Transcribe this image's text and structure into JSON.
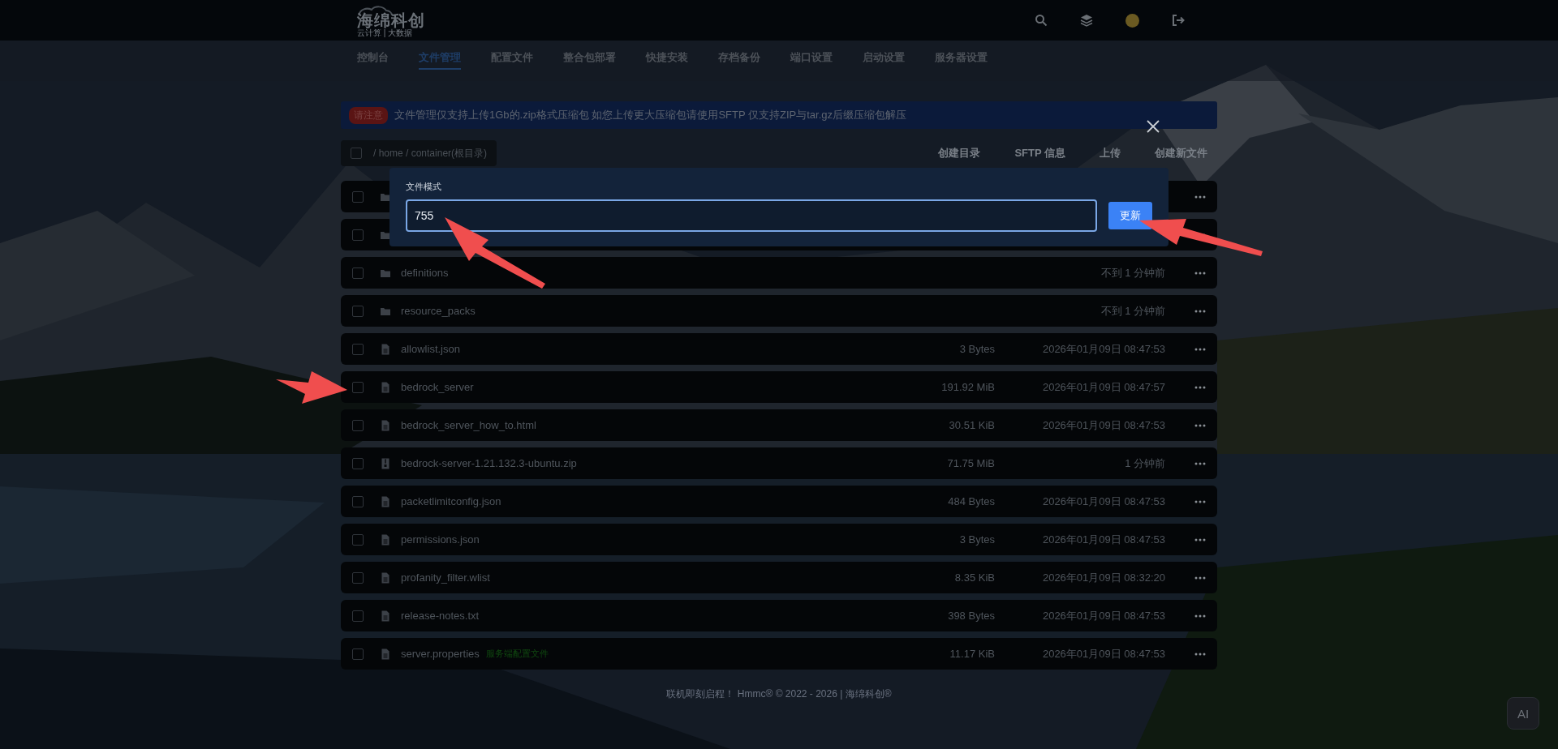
{
  "header": {
    "logo_title": "海绵科创",
    "logo_subtitle": "云计算 | 大数据"
  },
  "nav": [
    {
      "label": "控制台",
      "selected": false
    },
    {
      "label": "文件管理",
      "selected": true
    },
    {
      "label": "配置文件",
      "selected": false
    },
    {
      "label": "整合包部署",
      "selected": false
    },
    {
      "label": "快捷安装",
      "selected": false
    },
    {
      "label": "存档备份",
      "selected": false
    },
    {
      "label": "端口设置",
      "selected": false
    },
    {
      "label": "启动设置",
      "selected": false
    },
    {
      "label": "服务器设置",
      "selected": false
    }
  ],
  "notice": {
    "badge": "请注意",
    "text": "文件管理仅支持上传1Gb的.zip格式压缩包 如您上传更大压缩包请使用SFTP 仅支持ZIP与tar.gz后缀压缩包解压"
  },
  "toolbar": {
    "select_all_checked": false,
    "path": "/ home / container(根目录)",
    "actions": [
      "创建目录",
      "SFTP 信息",
      "上传",
      "创建新文件"
    ]
  },
  "files": [
    {
      "kind": "folder",
      "checked": false
    },
    {
      "kind": "folder",
      "checked": false
    },
    {
      "kind": "folder",
      "checked": false,
      "name": "definitions",
      "modified": "不到 1 分钟前"
    },
    {
      "kind": "folder",
      "checked": false,
      "name": "resource_packs",
      "modified": "不到 1 分钟前"
    },
    {
      "kind": "file",
      "checked": false,
      "name": "allowlist.json",
      "size": "3 Bytes",
      "modified": "2026年01月09日 08:47:53"
    },
    {
      "kind": "file",
      "checked": false,
      "name": "bedrock_server",
      "size": "191.92 MiB",
      "modified": "2026年01月09日 08:47:57"
    },
    {
      "kind": "file",
      "checked": false,
      "name": "bedrock_server_how_to.html",
      "size": "30.51 KiB",
      "modified": "2026年01月09日 08:47:53"
    },
    {
      "kind": "archive",
      "checked": false,
      "name": "bedrock-server-1.21.132.3-ubuntu.zip",
      "size": "71.75 MiB",
      "modified": "1 分钟前"
    },
    {
      "kind": "file",
      "checked": false,
      "name": "packetlimitconfig.json",
      "size": "484 Bytes",
      "modified": "2026年01月09日 08:47:53"
    },
    {
      "kind": "file",
      "checked": false,
      "name": "permissions.json",
      "size": "3 Bytes",
      "modified": "2026年01月09日 08:47:53"
    },
    {
      "kind": "file",
      "checked": false,
      "name": "profanity_filter.wlist",
      "size": "8.35 KiB",
      "modified": "2026年01月09日 08:32:20"
    },
    {
      "kind": "file",
      "checked": false,
      "name": "release-notes.txt",
      "size": "398 Bytes",
      "modified": "2026年01月09日 08:47:53"
    },
    {
      "kind": "file",
      "checked": false,
      "name": "server.properties",
      "tag": "服务端配置文件",
      "size": "11.17 KiB",
      "modified": "2026年01月09日 08:47:53"
    }
  ],
  "modal": {
    "label": "文件模式",
    "value": "755",
    "button": "更新"
  },
  "footer": "联机即刻启程！ Hmmc® © 2022 - 2026 | 海绵科创®",
  "ai_button": "AI"
}
